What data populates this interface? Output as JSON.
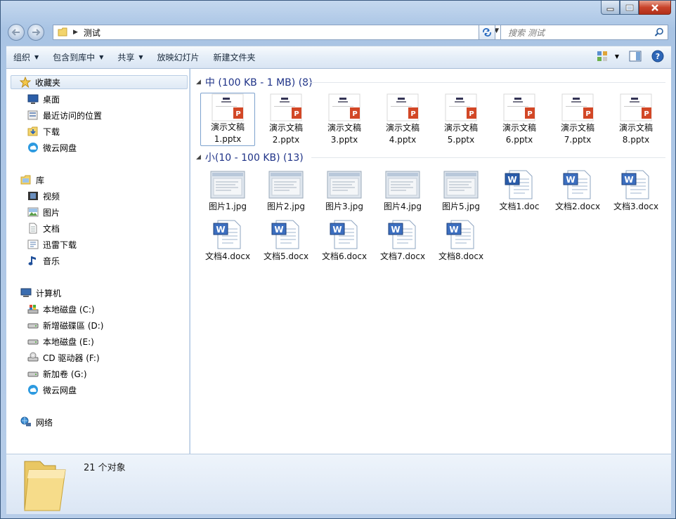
{
  "window": {
    "address_path": "测试",
    "search_placeholder": "搜索 测试"
  },
  "toolbar": {
    "organize": "组织",
    "include_in_library": "包含到库中",
    "share": "共享",
    "slideshow": "放映幻灯片",
    "new_folder": "新建文件夹"
  },
  "navigation": {
    "favorites_header": "收藏夹",
    "favorites": [
      "桌面",
      "最近访问的位置",
      "下载",
      "微云网盘"
    ],
    "libraries_header": "库",
    "libraries": [
      "视频",
      "图片",
      "文档",
      "迅雷下载",
      "音乐"
    ],
    "computer_header": "计算机",
    "drives": [
      "本地磁盘 (C:)",
      "新增磁碟區 (D:)",
      "本地磁盘 (E:)",
      "CD 驱动器 (F:)",
      "新加卷 (G:)",
      "微云网盘"
    ],
    "network_header": "网络"
  },
  "groups": [
    {
      "header": "中 (100 KB - 1 MB) (8)",
      "files": [
        {
          "name": "演示文稿",
          "ext": "1.pptx",
          "type": "pptx"
        },
        {
          "name": "演示文稿",
          "ext": "2.pptx",
          "type": "pptx"
        },
        {
          "name": "演示文稿",
          "ext": "3.pptx",
          "type": "pptx"
        },
        {
          "name": "演示文稿",
          "ext": "4.pptx",
          "type": "pptx"
        },
        {
          "name": "演示文稿",
          "ext": "5.pptx",
          "type": "pptx"
        },
        {
          "name": "演示文稿",
          "ext": "6.pptx",
          "type": "pptx"
        },
        {
          "name": "演示文稿",
          "ext": "7.pptx",
          "type": "pptx"
        },
        {
          "name": "演示文稿",
          "ext": "8.pptx",
          "type": "pptx"
        }
      ]
    },
    {
      "header": "小(10 - 100 KB) (13)",
      "files": [
        {
          "name": "图片1.jpg",
          "type": "jpg"
        },
        {
          "name": "图片2.jpg",
          "type": "jpg"
        },
        {
          "name": "图片3.jpg",
          "type": "jpg"
        },
        {
          "name": "图片4.jpg",
          "type": "jpg"
        },
        {
          "name": "图片5.jpg",
          "type": "jpg"
        },
        {
          "name": "文档1.doc",
          "type": "doc"
        },
        {
          "name": "文档2.docx",
          "type": "docx"
        },
        {
          "name": "文档3.docx",
          "type": "docx"
        },
        {
          "name": "文档4.docx",
          "type": "docx"
        },
        {
          "name": "文档5.docx",
          "type": "docx"
        },
        {
          "name": "文档6.docx",
          "type": "docx"
        },
        {
          "name": "文档7.docx",
          "type": "docx"
        },
        {
          "name": "文档8.docx",
          "type": "docx"
        }
      ]
    }
  ],
  "details": {
    "item_count": "21 个对象"
  },
  "colors": {
    "group_header": "#1e3287",
    "selection_border": "#7da2ce",
    "close_button": "#c8432b"
  }
}
